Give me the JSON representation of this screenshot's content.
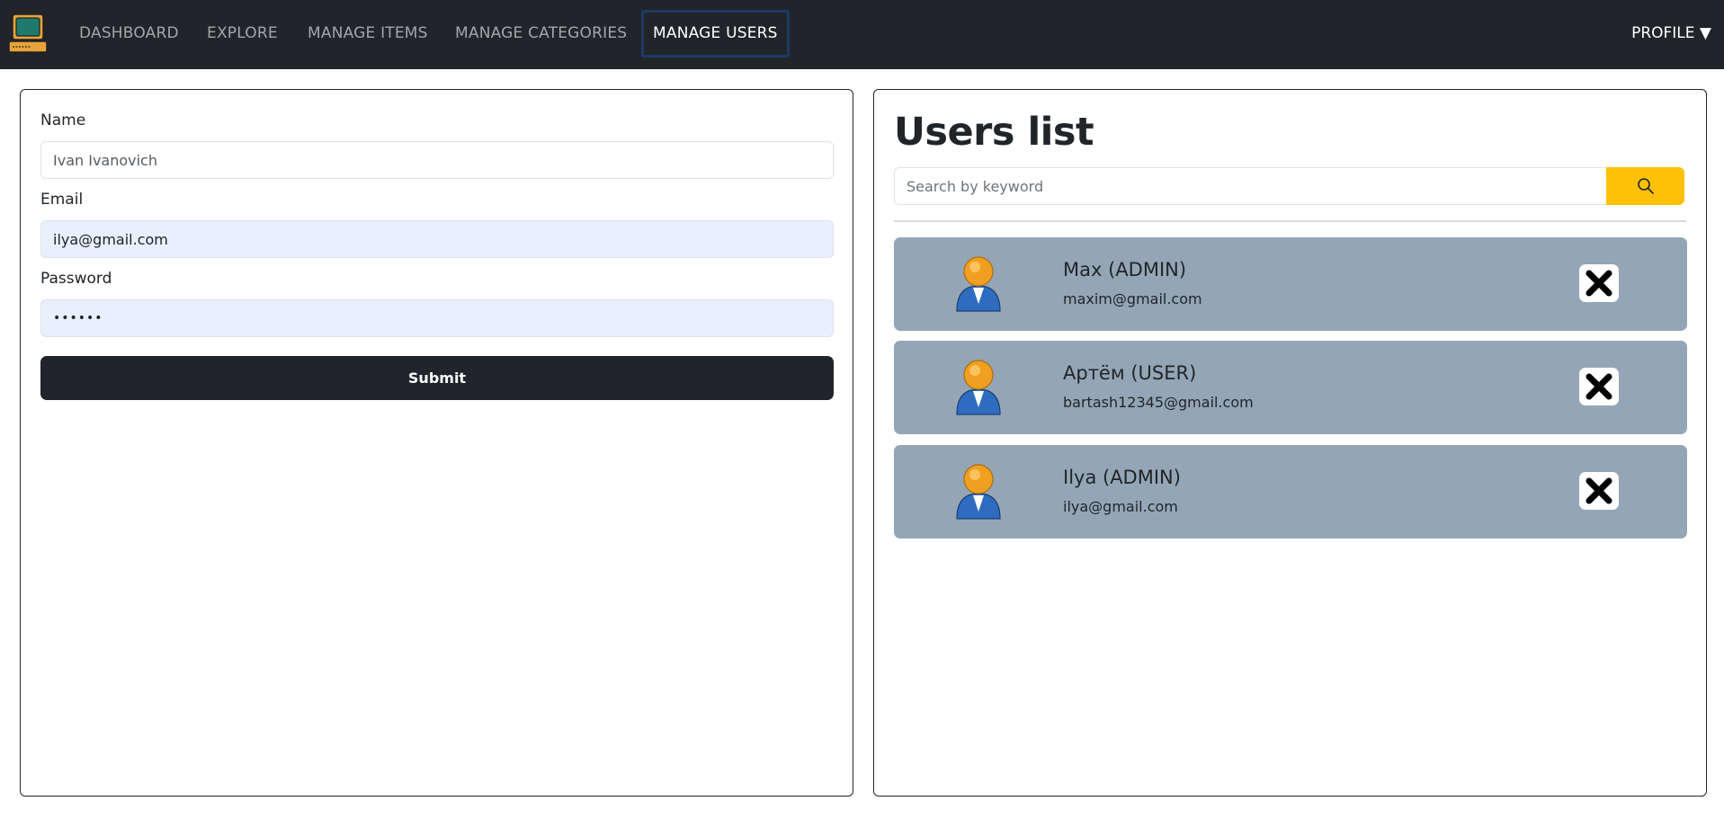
{
  "nav": {
    "links": [
      {
        "label": "DASHBOARD"
      },
      {
        "label": "EXPLORE"
      },
      {
        "label": "MANAGE ITEMS"
      },
      {
        "label": "MANAGE CATEGORIES"
      },
      {
        "label": "MANAGE USERS",
        "active": true
      }
    ],
    "profile_label": "PROFILE ▼",
    "logo_icon": "retro-computer-icon"
  },
  "form": {
    "name_label": "Name",
    "name_value": "Ivan Ivanovich",
    "email_label": "Email",
    "email_value": "ilya@gmail.com",
    "password_label": "Password",
    "password_value": "••••••",
    "submit_label": "Submit"
  },
  "users_list": {
    "title": "Users list",
    "search_placeholder": "Search by keyword",
    "search_icon": "search-icon",
    "users": [
      {
        "name": "Max (ADMIN)",
        "email": "maxim@gmail.com"
      },
      {
        "name": "Артём (USER)",
        "email": "bartash12345@gmail.com"
      },
      {
        "name": "Ilya (ADMIN)",
        "email": "ilya@gmail.com"
      }
    ]
  },
  "colors": {
    "navbar_bg": "#212529",
    "accent": "#ffc107",
    "card_bg": "#94a6b6",
    "autofill_bg": "#e8f0fe"
  }
}
